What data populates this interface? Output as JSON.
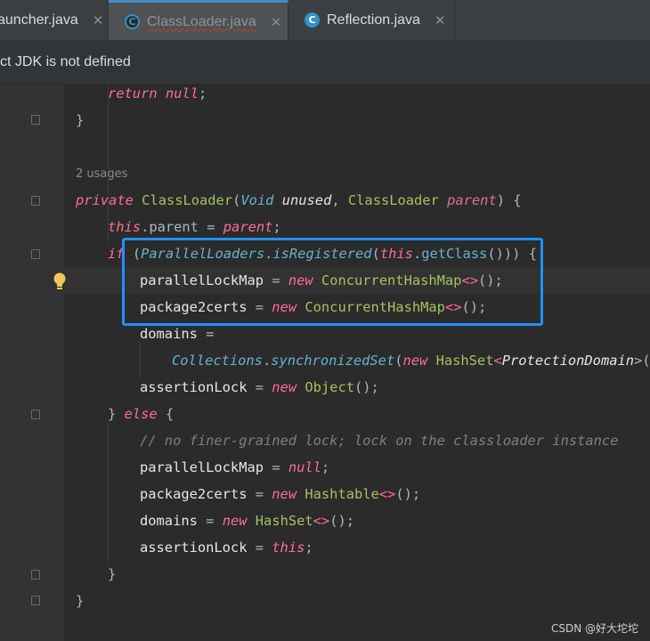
{
  "tabs": [
    {
      "label": "auncher.java",
      "icon": "java-class-icon"
    },
    {
      "label": "ClassLoader.java",
      "icon": "locked-java-class-icon",
      "active": true
    },
    {
      "label": "Reflection.java",
      "icon": "java-class-icon"
    }
  ],
  "banner": {
    "text": "ct JDK is not defined"
  },
  "editor": {
    "usages_hint": "2 usages",
    "lines": {
      "l1": {
        "kw1": "return",
        "lit1": "null",
        "p1": ";"
      },
      "l2": {
        "p1": "}"
      },
      "l5": {
        "kw1": "private",
        "t1": "ClassLoader",
        "p1": "(",
        "t2": "Void",
        "pm1": "unused",
        "p2": ", ",
        "t3": "ClassLoader",
        "pm2": "parent",
        "p3": ") {"
      },
      "l6": {
        "kw1": "this",
        "p1": ".parent",
        "p2": " = ",
        "pm1": "parent",
        "p3": ";"
      },
      "l7": {
        "kw1": "if",
        "p1": " (",
        "c1": "ParallelLoaders",
        "p2": ".",
        "m1": "isRegistered",
        "p3": "(",
        "kw2": "this",
        "p4": ".",
        "m2": "getClass",
        "p5": "())) {"
      },
      "l8": {
        "f1": "parallelLockMap",
        "p1": " = ",
        "kw1": "new",
        "t1": "ConcurrentHashMap",
        "p2": "<>",
        "p3": "();"
      },
      "l9": {
        "f1": "package2certs",
        "p1": " = ",
        "kw1": "new",
        "t1": "ConcurrentHashMap",
        "p2": "<>",
        "p3": "();"
      },
      "l10": {
        "f1": "domains",
        "p1": " ="
      },
      "l11": {
        "c1": "Collections",
        "p1": ".",
        "m1": "synchronizedSet",
        "p2": "(",
        "kw1": "new",
        "t1": "HashSet",
        "p3": "<",
        "t2": "ProtectionDomain",
        "p4": ">())"
      },
      "l12": {
        "f1": "assertionLock",
        "p1": " = ",
        "kw1": "new",
        "t1": "Object",
        "p2": "();"
      },
      "l13": {
        "p1": "} ",
        "kw1": "else",
        "p2": " {"
      },
      "l14": {
        "cm1": "// no finer-grained lock; lock on the classloader instance"
      },
      "l15": {
        "f1": "parallelLockMap",
        "p1": " = ",
        "lit1": "null",
        "p2": ";"
      },
      "l16": {
        "f1": "package2certs",
        "p1": " = ",
        "kw1": "new",
        "t1": "Hashtable",
        "p2": "<>",
        "p3": "();"
      },
      "l17": {
        "f1": "domains",
        "p1": " = ",
        "kw1": "new",
        "t1": "HashSet",
        "p2": "<>",
        "p3": "();"
      },
      "l18": {
        "f1": "assertionLock",
        "p1": " = ",
        "kw1": "this",
        "p2": ";"
      },
      "l19": {
        "p1": "}"
      },
      "l20": {
        "p1": "}"
      }
    }
  },
  "watermark": "CSDN @好大坨坨",
  "colors": {
    "selection_box": "#1e90ff",
    "active_tab_accent": "#4a88c7",
    "keyword": "#ff6b9a",
    "type": "#a5c261",
    "field": "#e6e6e6",
    "static_method": "#66b2cf"
  }
}
